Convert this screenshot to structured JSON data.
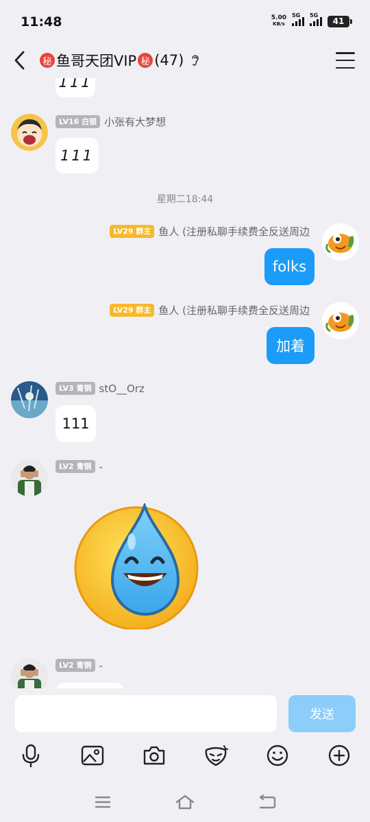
{
  "status": {
    "time": "11:48",
    "net_speed": "5.00",
    "net_unit": "KB/s",
    "sim1": "5G",
    "sim2": "5G",
    "battery": "41"
  },
  "header": {
    "secret_left": "秘",
    "group_name": "鱼哥天团VIP",
    "secret_right": "秘",
    "member_count": "(47)"
  },
  "messages": {
    "top_partial_text": "111",
    "m1": {
      "level": "LV16 白银",
      "nickname": "小张有大梦想",
      "text": "111"
    },
    "time_sep": "星期二18:44",
    "m2": {
      "level": "LV29 群主",
      "nickname": "鱼人 (注册私聊手续费全反送周边",
      "text": "folks"
    },
    "m3": {
      "level": "LV29 群主",
      "nickname": "鱼人 (注册私聊手续费全反送周边",
      "text": "加着"
    },
    "m4": {
      "level": "LV3 青铜",
      "nickname": "stO__Orz",
      "text": "111"
    },
    "m5": {
      "level": "LV2 青铜",
      "nickname": "-"
    },
    "m6": {
      "level": "LV2 青铜",
      "nickname": "-"
    }
  },
  "input": {
    "placeholder": "",
    "send_label": "发送"
  },
  "colors": {
    "accent": "#1a9cf8",
    "send_disabled": "#8ccdf9",
    "owner_badge": "#f7b829",
    "member_badge": "#b4b4ba",
    "background": "#f0f0f4"
  }
}
